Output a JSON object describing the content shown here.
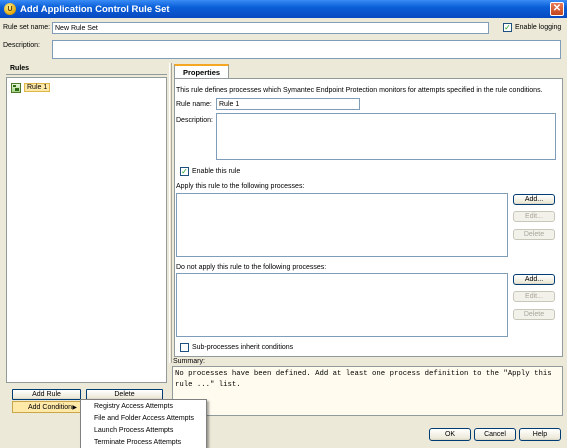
{
  "window": {
    "title": "Add Application Control Rule Set",
    "close_glyph": "✕"
  },
  "rule_set": {
    "name_label": "Rule set name:",
    "name_value": "New Rule Set",
    "enable_logging_label": "Enable logging",
    "enable_logging_checked": true,
    "description_label": "Description:",
    "description_value": ""
  },
  "rules_panel": {
    "title": "Rules",
    "items": [
      {
        "label": "Rule 1",
        "icon": "rule-icon",
        "selected": true
      }
    ],
    "add_rule_label": "Add Rule",
    "delete_label": "Delete",
    "add_condition_label": "Add Condition"
  },
  "context_menu": {
    "items": [
      "Registry Access Attempts",
      "File and Folder Access Attempts",
      "Launch Process Attempts",
      "Terminate Process Attempts"
    ]
  },
  "properties": {
    "tab_label": "Properties",
    "intro": "This rule defines processes which Symantec Endpoint Protection monitors for attempts specified in the rule conditions.",
    "rule_name_label": "Rule name:",
    "rule_name_value": "Rule 1",
    "description_label": "Description:",
    "description_value": "",
    "enable_rule_label": "Enable this rule",
    "enable_rule_checked": true,
    "apply_label": "Apply this rule to the following processes:",
    "apply_buttons": {
      "add": "Add...",
      "edit": "Edit...",
      "delete": "Delete"
    },
    "not_apply_label": "Do not apply this rule to the following processes:",
    "not_apply_buttons": {
      "add": "Add...",
      "edit": "Edit...",
      "delete": "Delete"
    },
    "subprocess_label": "Sub-processes inherit conditions",
    "subprocess_checked": false
  },
  "summary": {
    "label": "Summary:",
    "text": "No processes have been defined. Add at least one process definition to the \"Apply this rule ...\" list."
  },
  "footer": {
    "ok_label": "OK",
    "cancel_label": "Cancel",
    "help_label": "Help"
  },
  "colors": {
    "titlebar": "#0a5fd8",
    "selection": "#ffe9a8",
    "window_bg": "#ece9d8"
  }
}
